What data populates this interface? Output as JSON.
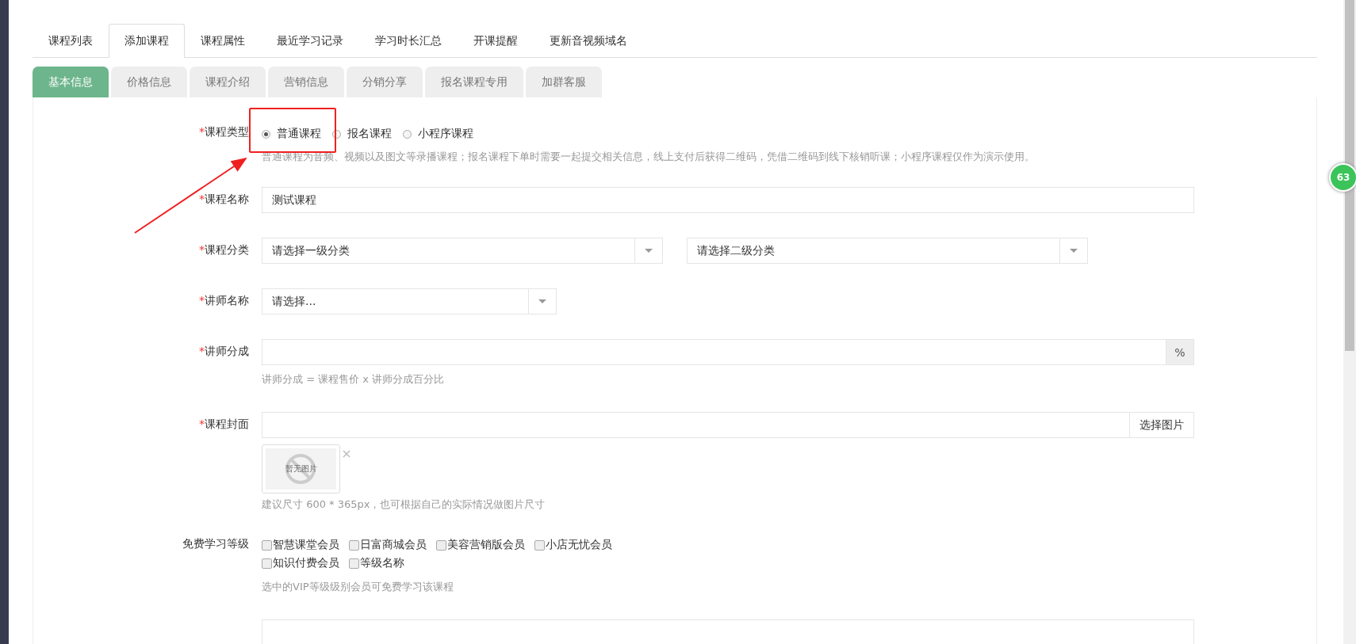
{
  "main_tabs": [
    {
      "label": "课程列表",
      "selected": false
    },
    {
      "label": "添加课程",
      "selected": true
    },
    {
      "label": "课程属性",
      "selected": false
    },
    {
      "label": "最近学习记录",
      "selected": false
    },
    {
      "label": "学习时长汇总",
      "selected": false
    },
    {
      "label": "开课提醒",
      "selected": false
    },
    {
      "label": "更新音视频域名",
      "selected": false
    }
  ],
  "sub_tabs": [
    {
      "label": "基本信息",
      "selected": true
    },
    {
      "label": "价格信息",
      "selected": false
    },
    {
      "label": "课程介绍",
      "selected": false
    },
    {
      "label": "营销信息",
      "selected": false
    },
    {
      "label": "分销分享",
      "selected": false
    },
    {
      "label": "报名课程专用",
      "selected": false
    },
    {
      "label": "加群客服",
      "selected": false
    }
  ],
  "form": [
    {
      "kind": "radio",
      "label": "课程类型",
      "required_mark": "*",
      "options": [
        {
          "label": "普通课程",
          "selected": true
        },
        {
          "label": "报名课程",
          "selected": false
        },
        {
          "label": "小程序课程",
          "selected": false
        }
      ],
      "help": "普通课程为音频、视频以及图文等录播课程；报名课程下单时需要一起提交相关信息，线上支付后获得二维码，凭借二维码到线下核销听课；小程序课程仅作为演示使用。"
    },
    {
      "kind": "text",
      "label": "课程名称",
      "required_mark": "*",
      "value": "测试课程"
    },
    {
      "kind": "selects",
      "label": "课程分类",
      "required_mark": "*",
      "selects": [
        {
          "value": "请选择一级分类"
        },
        {
          "value": "请选择二级分类"
        }
      ]
    },
    {
      "kind": "select",
      "label": "讲师名称",
      "required_mark": "*",
      "value": "请选择..."
    },
    {
      "kind": "addon",
      "label": "讲师分成",
      "required_mark": "*",
      "addon": "%",
      "help": "讲师分成 = 课程售价 x 讲师分成百分比"
    },
    {
      "kind": "image",
      "label": "课程封面",
      "required_mark": "*",
      "button": "选择图片",
      "placeholder_text": "暂无图片",
      "help": "建议尺寸 600 * 365px，也可根据自己的实际情况做图片尺寸"
    },
    {
      "kind": "checkboxes",
      "label": "免费学习等级",
      "options": [
        {
          "label": "智慧课堂会员",
          "checked": false
        },
        {
          "label": "日富商城会员",
          "checked": false
        },
        {
          "label": "美容营销版会员",
          "checked": false
        },
        {
          "label": "小店无忧会员",
          "checked": false
        },
        {
          "label": "知识付费会员",
          "checked": false
        },
        {
          "label": "等级名称",
          "checked": false
        }
      ],
      "help": "选中的VIP等级级别会员可免费学习该课程"
    },
    {
      "kind": "text"
    }
  ],
  "badge": {
    "text": "63"
  }
}
